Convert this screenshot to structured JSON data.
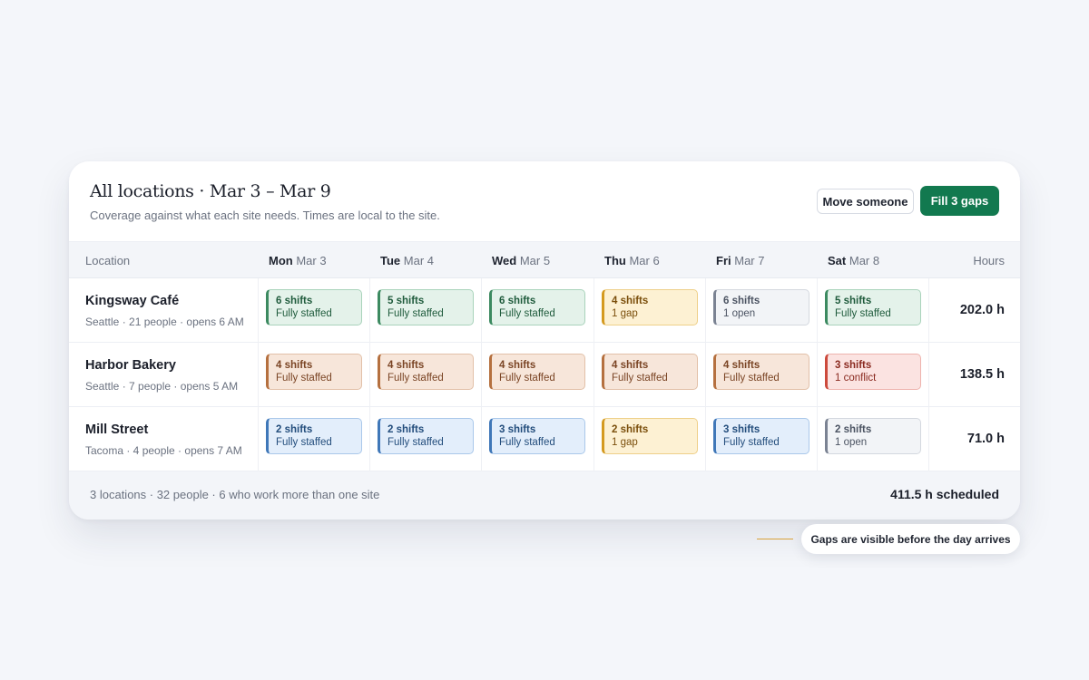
{
  "header": {
    "title": "All locations · Mar 3 – Mar 9",
    "subtitle": "Coverage against what each site needs. Times are local to the site.",
    "secondary_button": "Move someone",
    "primary_button": "Fill 3 gaps"
  },
  "columns": {
    "location": "Location",
    "hours": "Hours",
    "days": [
      {
        "dow": "Mon",
        "date": "Mar 3"
      },
      {
        "dow": "Tue",
        "date": "Mar 4"
      },
      {
        "dow": "Wed",
        "date": "Mar 5"
      },
      {
        "dow": "Thu",
        "date": "Mar 6"
      },
      {
        "dow": "Fri",
        "date": "Mar 7"
      },
      {
        "dow": "Sat",
        "date": "Mar 8"
      }
    ]
  },
  "rows": [
    {
      "name": "Kingsway Café",
      "meta": "Seattle · 21 people · opens 6 AM",
      "hours": "202.0 h",
      "days": [
        {
          "count": "6 shifts",
          "status": "Fully staffed",
          "state": "green"
        },
        {
          "count": "5 shifts",
          "status": "Fully staffed",
          "state": "green"
        },
        {
          "count": "6 shifts",
          "status": "Fully staffed",
          "state": "green"
        },
        {
          "count": "4 shifts",
          "status": "1 gap",
          "state": "amber"
        },
        {
          "count": "6 shifts",
          "status": "1 open",
          "state": "gray"
        },
        {
          "count": "5 shifts",
          "status": "Fully staffed",
          "state": "green"
        }
      ]
    },
    {
      "name": "Harbor Bakery",
      "meta": "Seattle · 7 people · opens 5 AM",
      "hours": "138.5 h",
      "days": [
        {
          "count": "4 shifts",
          "status": "Fully staffed",
          "state": "tan"
        },
        {
          "count": "4 shifts",
          "status": "Fully staffed",
          "state": "tan"
        },
        {
          "count": "4 shifts",
          "status": "Fully staffed",
          "state": "tan"
        },
        {
          "count": "4 shifts",
          "status": "Fully staffed",
          "state": "tan"
        },
        {
          "count": "4 shifts",
          "status": "Fully staffed",
          "state": "tan"
        },
        {
          "count": "3 shifts",
          "status": "1 conflict",
          "state": "red"
        }
      ]
    },
    {
      "name": "Mill Street",
      "meta": "Tacoma · 4 people · opens 7 AM",
      "hours": "71.0 h",
      "days": [
        {
          "count": "2 shifts",
          "status": "Fully staffed",
          "state": "blue"
        },
        {
          "count": "2 shifts",
          "status": "Fully staffed",
          "state": "blue"
        },
        {
          "count": "3 shifts",
          "status": "Fully staffed",
          "state": "blue"
        },
        {
          "count": "2 shifts",
          "status": "1 gap",
          "state": "amber"
        },
        {
          "count": "3 shifts",
          "status": "Fully staffed",
          "state": "blue"
        },
        {
          "count": "2 shifts",
          "status": "1 open",
          "state": "gray"
        }
      ]
    }
  ],
  "footer": {
    "summary": "3 locations · 32 people · 6 who work more than one site",
    "total": "411.5 h scheduled"
  },
  "callout": "Gaps are visible before the day arrives",
  "colors": {
    "accent": "#12794f",
    "callout_line": "#d8a23a",
    "states": {
      "green": {
        "bg": "#e4f2ea",
        "border": "#a9d3bb",
        "bar": "#3c8a60",
        "text": "#1f5b3c"
      },
      "amber": {
        "bg": "#fdf1d3",
        "border": "#eed08a",
        "bar": "#d49a20",
        "text": "#7a4e0b"
      },
      "gray": {
        "bg": "#f2f4f7",
        "border": "#d4d8df",
        "bar": "#7a8292",
        "text": "#4b5362"
      },
      "tan": {
        "bg": "#f7e6da",
        "border": "#e2c0a8",
        "bar": "#b5703f",
        "text": "#7a4424"
      },
      "red": {
        "bg": "#fbe3e1",
        "border": "#eeb3ad",
        "bar": "#cc4a3c",
        "text": "#8a2a20"
      },
      "blue": {
        "bg": "#e3eefb",
        "border": "#aac8ea",
        "bar": "#3f77b8",
        "text": "#234d7c"
      }
    }
  }
}
